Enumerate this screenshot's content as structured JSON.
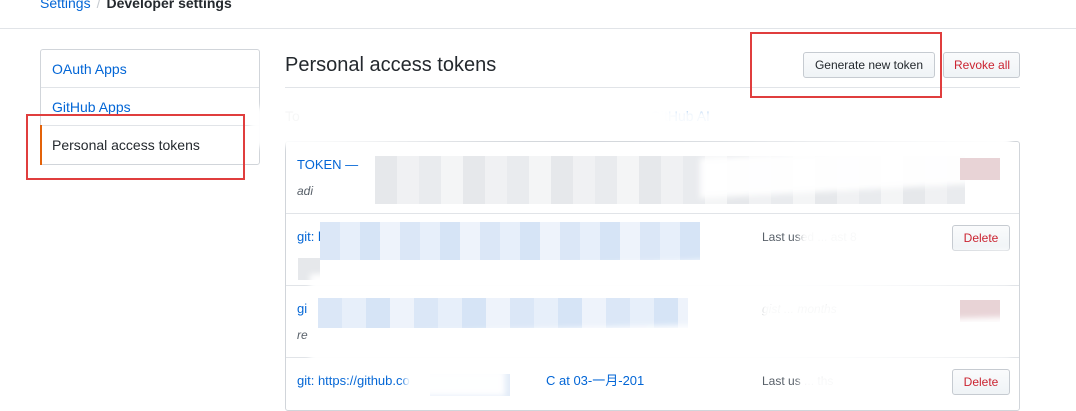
{
  "breadcrumb": {
    "settings": "Settings",
    "separator": "/",
    "current": "Developer settings"
  },
  "sidebar": {
    "items": [
      {
        "label": "OAuth Apps"
      },
      {
        "label": "GitHub Apps"
      },
      {
        "label": "Personal access tokens"
      }
    ]
  },
  "main": {
    "title": "Personal access tokens",
    "generate_label": "Generate new token",
    "revoke_all_label": "Revoke all",
    "description_start": "To",
    "description_link": "GitHub AI"
  },
  "tokens": [
    {
      "name": "TOKEN —",
      "scope": "adi",
      "usage": "",
      "delete_label": ""
    },
    {
      "name": "git: h",
      "scope": "",
      "usage": "Last used ... ast 8",
      "delete_label": "Delete"
    },
    {
      "name": "gi",
      "scope": "re",
      "usage": "gist ... months",
      "delete_label": ""
    },
    {
      "name": "git: https://github.co",
      "scope": "",
      "usage": "Last us ... ths",
      "delete_label": "Delete",
      "name_tail": "C at 03-一月-201"
    }
  ],
  "colors": {
    "link": "#0366d6",
    "danger": "#cb2431",
    "selected_marker": "#e36209",
    "annotation": "#e03e3e"
  }
}
